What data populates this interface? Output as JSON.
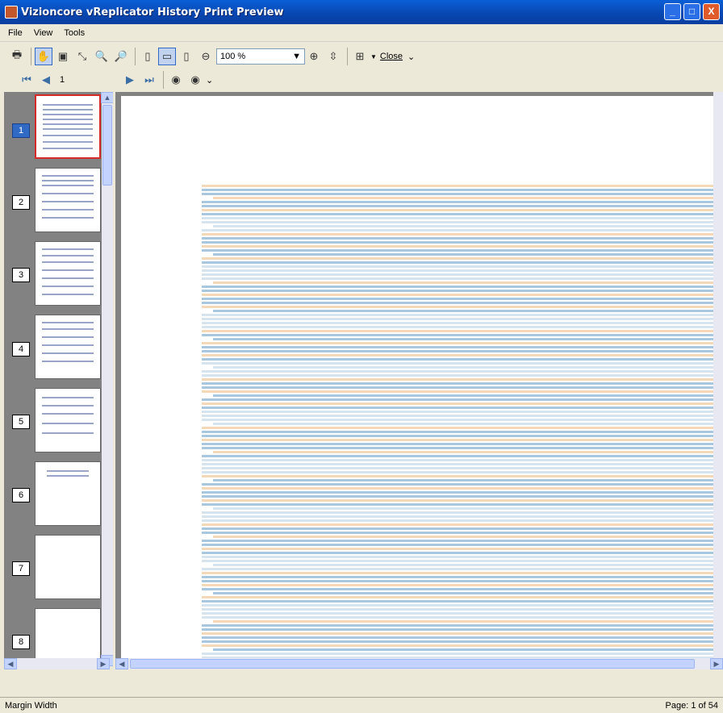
{
  "window": {
    "title": "Vizioncore vReplicator History Print Preview",
    "minimize": "_",
    "maximize": "□",
    "close": "X"
  },
  "menu": {
    "items": [
      "File",
      "View",
      "Tools"
    ]
  },
  "toolbar": {
    "zoom_value": "100 %",
    "close_label": "Close"
  },
  "nav": {
    "page_input": "1"
  },
  "thumbnails": {
    "pages": [
      "1",
      "2",
      "3",
      "4",
      "5",
      "6",
      "7",
      "8"
    ]
  },
  "status": {
    "left": "Margin Width",
    "right": "Page: 1 of 54"
  },
  "colors": {
    "titlebar": "#0a5fd6",
    "selected_page": "#316ac5",
    "thumb_border": "#d42a2a",
    "row_blue": "#a9c8e0",
    "row_orange": "#f3d9b8"
  }
}
